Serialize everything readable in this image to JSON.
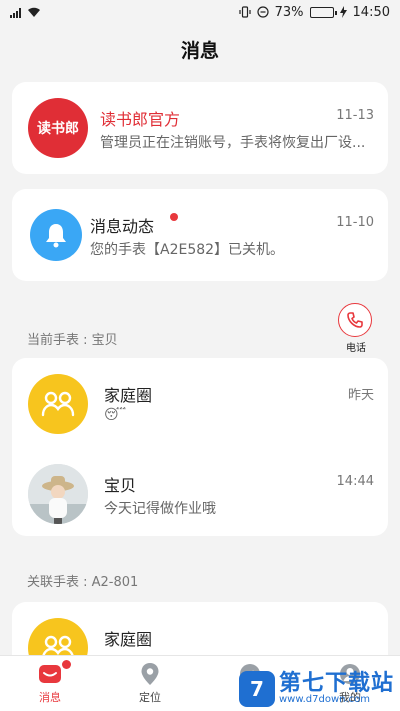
{
  "status_bar": {
    "battery_text": "73%",
    "time": "14:50",
    "battery_level": 0.73
  },
  "page_title": "消息",
  "official": {
    "avatar_text": "读书郎",
    "title": "读书郎官方",
    "subtitle": "管理员正在注销账号，手表将恢复出厂设...",
    "time": "11-13"
  },
  "notification": {
    "title": "消息动态",
    "subtitle": "您的手表【A2E582】已关机。",
    "time": "11-10"
  },
  "current_watch": {
    "label": "当前手表 : 宝贝",
    "call_label": "电话",
    "rows": [
      {
        "title": "家庭圈",
        "subtitle": "😴",
        "time": "昨天"
      },
      {
        "title": "宝贝",
        "subtitle": "今天记得做作业哦",
        "time": "14:44"
      }
    ]
  },
  "linked_watch": {
    "label": "关联手表 : A2-801",
    "rows": [
      {
        "title": "家庭圈"
      }
    ]
  },
  "tabbar": {
    "tabs": [
      {
        "label": "消息",
        "active": true
      },
      {
        "label": "定位",
        "active": false
      },
      {
        "label": "发现",
        "active": false
      },
      {
        "label": "我的",
        "active": false
      }
    ]
  },
  "watermark": {
    "logo": "7",
    "name": "第七下载站",
    "url": "www.d7down.com"
  },
  "colors": {
    "accent": "#e8383d",
    "bell": "#3aa7f5",
    "family": "#f7c51e"
  }
}
